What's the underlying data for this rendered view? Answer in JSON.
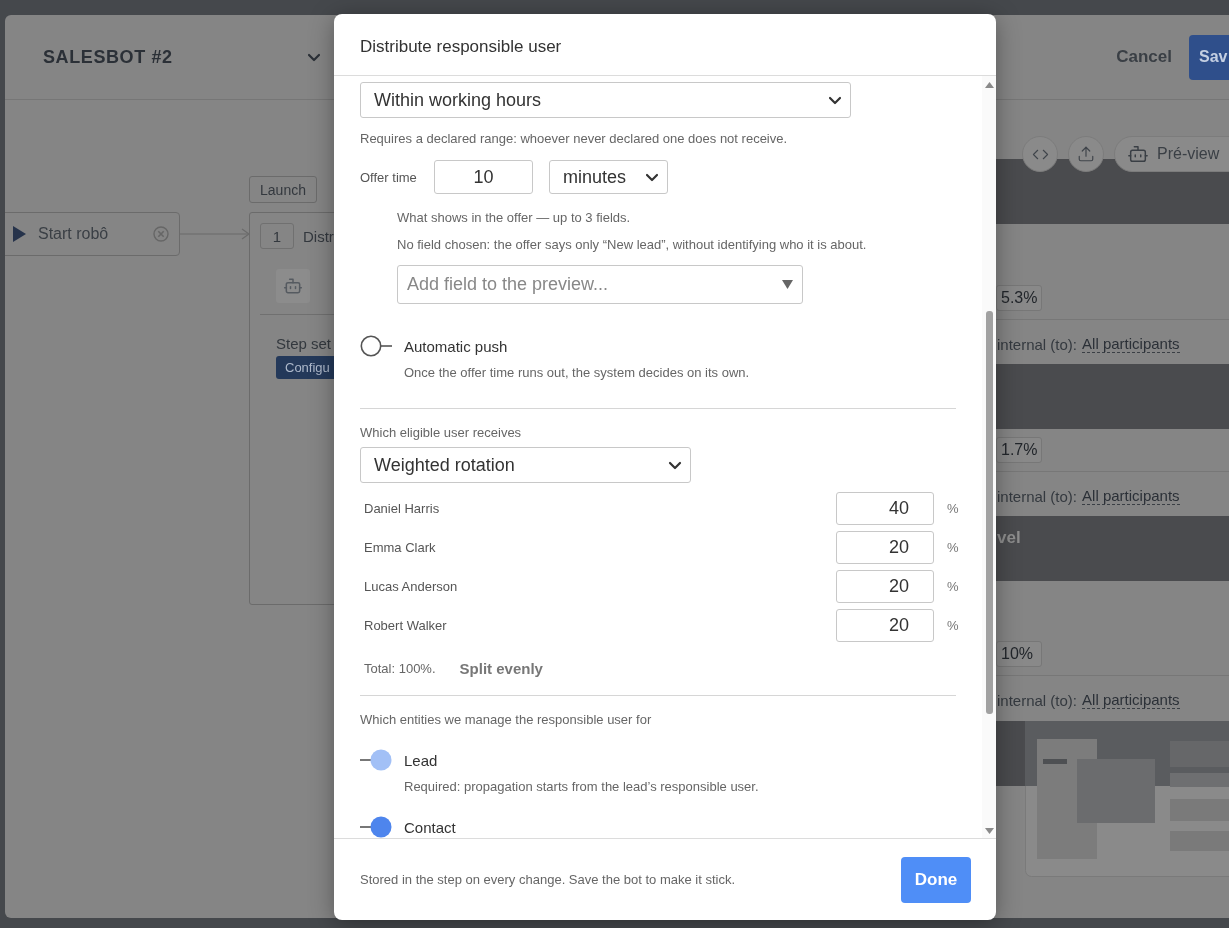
{
  "background": {
    "title": "SALESBOT #2",
    "actions": [
      {
        "kind": "link",
        "label": "Cancel"
      },
      {
        "kind": "primary",
        "label": "Sav"
      }
    ],
    "flow": {
      "start_node": "Start robô",
      "step_tag": "Launch",
      "step_number": "1",
      "step_title": "Distr",
      "settings_label": "Step set",
      "configure_button": "Configu"
    },
    "preview_button": "Pré-view",
    "cards": [
      {
        "value": "5.3%",
        "recipients_label": "internal (to):",
        "recipients": "All participants"
      },
      {
        "value": "1.7%",
        "recipients_label": "internal (to):",
        "recipients": "All participants"
      },
      {
        "heading": "vel",
        "value": "10%",
        "recipients_label": "internal (to):",
        "recipients": "All participants"
      }
    ]
  },
  "dialog": {
    "title": "Distribute responsible user",
    "schedule": {
      "value": "Within working hours",
      "hint": "Requires a declared range: whoever never declared one does not receive."
    },
    "offer_time": {
      "label": "Offer time",
      "value": "10",
      "unit": "minutes"
    },
    "preview_fields": {
      "hint": "What shows in the offer — up to 3 fields.",
      "note": "No field chosen: the offer says only “New lead”, without identifying who it is about.",
      "placeholder": "Add field to the preview..."
    },
    "auto_push": {
      "label": "Automatic push",
      "on": false,
      "description": "Once the offer time runs out, the system decides on its own."
    },
    "receiver": {
      "label": "Which eligible user receives",
      "value": "Weighted rotation",
      "users": [
        {
          "name": "Daniel Harris",
          "weight": "40",
          "unit": "%"
        },
        {
          "name": "Emma Clark",
          "weight": "20",
          "unit": "%"
        },
        {
          "name": "Lucas Anderson",
          "weight": "20",
          "unit": "%"
        },
        {
          "name": "Robert Walker",
          "weight": "20",
          "unit": "%"
        }
      ],
      "total": "Total: 100%.",
      "split_button": "Split evenly"
    },
    "entities": {
      "label": "Which entities we manage the responsible user for",
      "items": [
        {
          "name": "Lead",
          "on": true,
          "disabled": true,
          "description": "Required: propagation starts from the lead’s responsible user."
        },
        {
          "name": "Contact",
          "on": true,
          "disabled": false
        }
      ]
    },
    "footer": {
      "note": "Stored in the step on every change. Save the bot to make it stick.",
      "done_button": "Done"
    }
  }
}
